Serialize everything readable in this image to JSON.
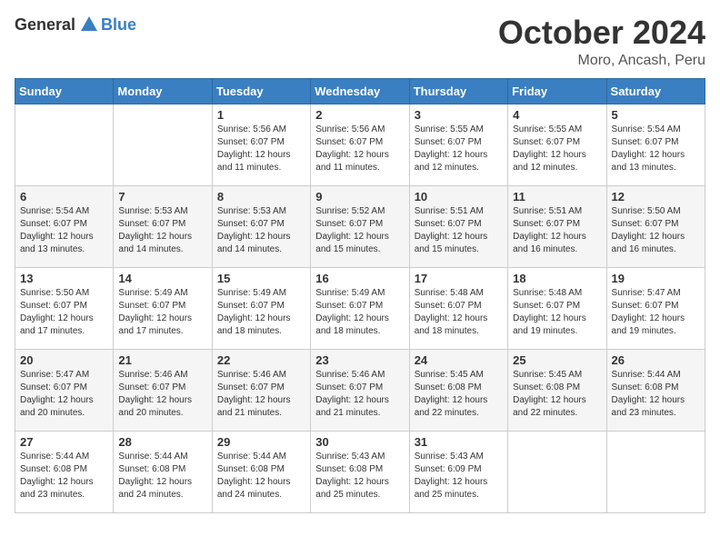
{
  "logo": {
    "general": "General",
    "blue": "Blue"
  },
  "title": {
    "month": "October 2024",
    "location": "Moro, Ancash, Peru"
  },
  "weekdays": [
    "Sunday",
    "Monday",
    "Tuesday",
    "Wednesday",
    "Thursday",
    "Friday",
    "Saturday"
  ],
  "weeks": [
    [
      {
        "day": "",
        "sunrise": "",
        "sunset": "",
        "daylight": ""
      },
      {
        "day": "",
        "sunrise": "",
        "sunset": "",
        "daylight": ""
      },
      {
        "day": "1",
        "sunrise": "Sunrise: 5:56 AM",
        "sunset": "Sunset: 6:07 PM",
        "daylight": "Daylight: 12 hours and 11 minutes."
      },
      {
        "day": "2",
        "sunrise": "Sunrise: 5:56 AM",
        "sunset": "Sunset: 6:07 PM",
        "daylight": "Daylight: 12 hours and 11 minutes."
      },
      {
        "day": "3",
        "sunrise": "Sunrise: 5:55 AM",
        "sunset": "Sunset: 6:07 PM",
        "daylight": "Daylight: 12 hours and 12 minutes."
      },
      {
        "day": "4",
        "sunrise": "Sunrise: 5:55 AM",
        "sunset": "Sunset: 6:07 PM",
        "daylight": "Daylight: 12 hours and 12 minutes."
      },
      {
        "day": "5",
        "sunrise": "Sunrise: 5:54 AM",
        "sunset": "Sunset: 6:07 PM",
        "daylight": "Daylight: 12 hours and 13 minutes."
      }
    ],
    [
      {
        "day": "6",
        "sunrise": "Sunrise: 5:54 AM",
        "sunset": "Sunset: 6:07 PM",
        "daylight": "Daylight: 12 hours and 13 minutes."
      },
      {
        "day": "7",
        "sunrise": "Sunrise: 5:53 AM",
        "sunset": "Sunset: 6:07 PM",
        "daylight": "Daylight: 12 hours and 14 minutes."
      },
      {
        "day": "8",
        "sunrise": "Sunrise: 5:53 AM",
        "sunset": "Sunset: 6:07 PM",
        "daylight": "Daylight: 12 hours and 14 minutes."
      },
      {
        "day": "9",
        "sunrise": "Sunrise: 5:52 AM",
        "sunset": "Sunset: 6:07 PM",
        "daylight": "Daylight: 12 hours and 15 minutes."
      },
      {
        "day": "10",
        "sunrise": "Sunrise: 5:51 AM",
        "sunset": "Sunset: 6:07 PM",
        "daylight": "Daylight: 12 hours and 15 minutes."
      },
      {
        "day": "11",
        "sunrise": "Sunrise: 5:51 AM",
        "sunset": "Sunset: 6:07 PM",
        "daylight": "Daylight: 12 hours and 16 minutes."
      },
      {
        "day": "12",
        "sunrise": "Sunrise: 5:50 AM",
        "sunset": "Sunset: 6:07 PM",
        "daylight": "Daylight: 12 hours and 16 minutes."
      }
    ],
    [
      {
        "day": "13",
        "sunrise": "Sunrise: 5:50 AM",
        "sunset": "Sunset: 6:07 PM",
        "daylight": "Daylight: 12 hours and 17 minutes."
      },
      {
        "day": "14",
        "sunrise": "Sunrise: 5:49 AM",
        "sunset": "Sunset: 6:07 PM",
        "daylight": "Daylight: 12 hours and 17 minutes."
      },
      {
        "day": "15",
        "sunrise": "Sunrise: 5:49 AM",
        "sunset": "Sunset: 6:07 PM",
        "daylight": "Daylight: 12 hours and 18 minutes."
      },
      {
        "day": "16",
        "sunrise": "Sunrise: 5:49 AM",
        "sunset": "Sunset: 6:07 PM",
        "daylight": "Daylight: 12 hours and 18 minutes."
      },
      {
        "day": "17",
        "sunrise": "Sunrise: 5:48 AM",
        "sunset": "Sunset: 6:07 PM",
        "daylight": "Daylight: 12 hours and 18 minutes."
      },
      {
        "day": "18",
        "sunrise": "Sunrise: 5:48 AM",
        "sunset": "Sunset: 6:07 PM",
        "daylight": "Daylight: 12 hours and 19 minutes."
      },
      {
        "day": "19",
        "sunrise": "Sunrise: 5:47 AM",
        "sunset": "Sunset: 6:07 PM",
        "daylight": "Daylight: 12 hours and 19 minutes."
      }
    ],
    [
      {
        "day": "20",
        "sunrise": "Sunrise: 5:47 AM",
        "sunset": "Sunset: 6:07 PM",
        "daylight": "Daylight: 12 hours and 20 minutes."
      },
      {
        "day": "21",
        "sunrise": "Sunrise: 5:46 AM",
        "sunset": "Sunset: 6:07 PM",
        "daylight": "Daylight: 12 hours and 20 minutes."
      },
      {
        "day": "22",
        "sunrise": "Sunrise: 5:46 AM",
        "sunset": "Sunset: 6:07 PM",
        "daylight": "Daylight: 12 hours and 21 minutes."
      },
      {
        "day": "23",
        "sunrise": "Sunrise: 5:46 AM",
        "sunset": "Sunset: 6:07 PM",
        "daylight": "Daylight: 12 hours and 21 minutes."
      },
      {
        "day": "24",
        "sunrise": "Sunrise: 5:45 AM",
        "sunset": "Sunset: 6:08 PM",
        "daylight": "Daylight: 12 hours and 22 minutes."
      },
      {
        "day": "25",
        "sunrise": "Sunrise: 5:45 AM",
        "sunset": "Sunset: 6:08 PM",
        "daylight": "Daylight: 12 hours and 22 minutes."
      },
      {
        "day": "26",
        "sunrise": "Sunrise: 5:44 AM",
        "sunset": "Sunset: 6:08 PM",
        "daylight": "Daylight: 12 hours and 23 minutes."
      }
    ],
    [
      {
        "day": "27",
        "sunrise": "Sunrise: 5:44 AM",
        "sunset": "Sunset: 6:08 PM",
        "daylight": "Daylight: 12 hours and 23 minutes."
      },
      {
        "day": "28",
        "sunrise": "Sunrise: 5:44 AM",
        "sunset": "Sunset: 6:08 PM",
        "daylight": "Daylight: 12 hours and 24 minutes."
      },
      {
        "day": "29",
        "sunrise": "Sunrise: 5:44 AM",
        "sunset": "Sunset: 6:08 PM",
        "daylight": "Daylight: 12 hours and 24 minutes."
      },
      {
        "day": "30",
        "sunrise": "Sunrise: 5:43 AM",
        "sunset": "Sunset: 6:08 PM",
        "daylight": "Daylight: 12 hours and 25 minutes."
      },
      {
        "day": "31",
        "sunrise": "Sunrise: 5:43 AM",
        "sunset": "Sunset: 6:09 PM",
        "daylight": "Daylight: 12 hours and 25 minutes."
      },
      {
        "day": "",
        "sunrise": "",
        "sunset": "",
        "daylight": ""
      },
      {
        "day": "",
        "sunrise": "",
        "sunset": "",
        "daylight": ""
      }
    ]
  ]
}
